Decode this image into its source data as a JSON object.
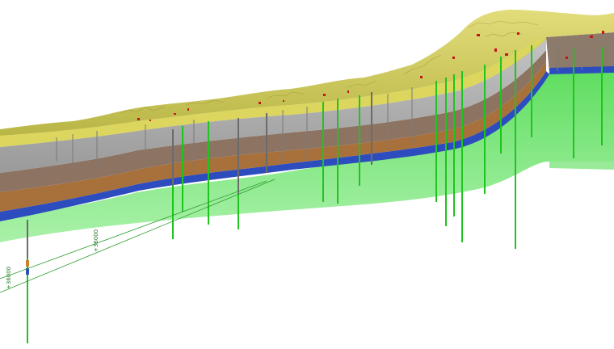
{
  "viewport": {
    "background": "#ffffff"
  },
  "model": {
    "layers": [
      {
        "name": "terrain-surface",
        "color": "#c9c85a"
      },
      {
        "name": "quaternary-yellow",
        "color": "#d9d44a"
      },
      {
        "name": "grey-clay",
        "color": "#a9a9a9"
      },
      {
        "name": "brown-marl",
        "color": "#8b6a4a"
      },
      {
        "name": "orange-sand",
        "color": "#c9812a"
      },
      {
        "name": "blue-aquifer",
        "color": "#2f4fc0"
      },
      {
        "name": "green-bedrock",
        "color": "#5ee05e"
      }
    ],
    "borehole_color": "#1fc41f",
    "borehole_top_color": "#6b6b6b",
    "marker_color": "#c01818"
  },
  "axis": {
    "ticks": [
      {
        "label": "+36000"
      },
      {
        "label": "+36000"
      }
    ],
    "color": "#2a9a2a"
  }
}
